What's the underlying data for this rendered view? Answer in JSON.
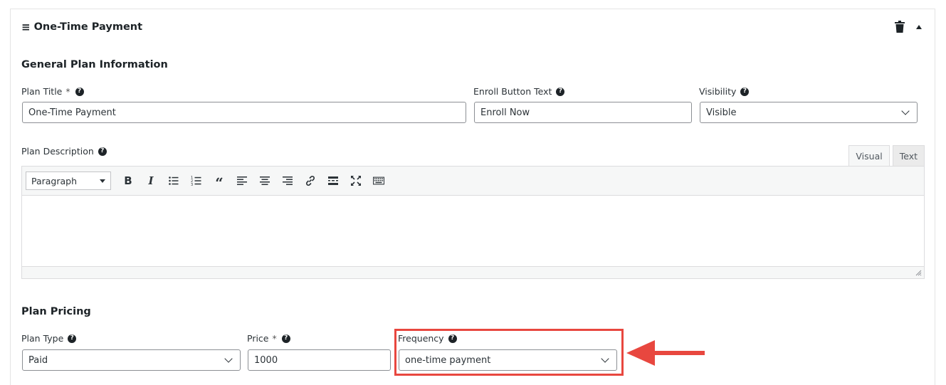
{
  "header": {
    "title": "One-Time Payment",
    "menu_glyph": "≡"
  },
  "general": {
    "title": "General Plan Information",
    "plan_title": {
      "label": "Plan Title",
      "required_mark": "*",
      "value": "One-Time Payment"
    },
    "enroll_text": {
      "label": "Enroll Button Text",
      "value": "Enroll Now"
    },
    "visibility": {
      "label": "Visibility",
      "value": "Visible"
    },
    "description": {
      "label": "Plan Description"
    }
  },
  "editor": {
    "tabs": [
      "Visual",
      "Text"
    ],
    "format": "Paragraph"
  },
  "pricing": {
    "title": "Plan Pricing",
    "plan_type": {
      "label": "Plan Type",
      "value": "Paid"
    },
    "price": {
      "label": "Price",
      "required_mark": "*",
      "value": "1000"
    },
    "frequency": {
      "label": "Frequency",
      "value": "one-time payment"
    }
  },
  "help_glyph": "?",
  "colors": {
    "highlight": "#e8473f",
    "text": "#1d2327",
    "border": "#8c8f94"
  }
}
